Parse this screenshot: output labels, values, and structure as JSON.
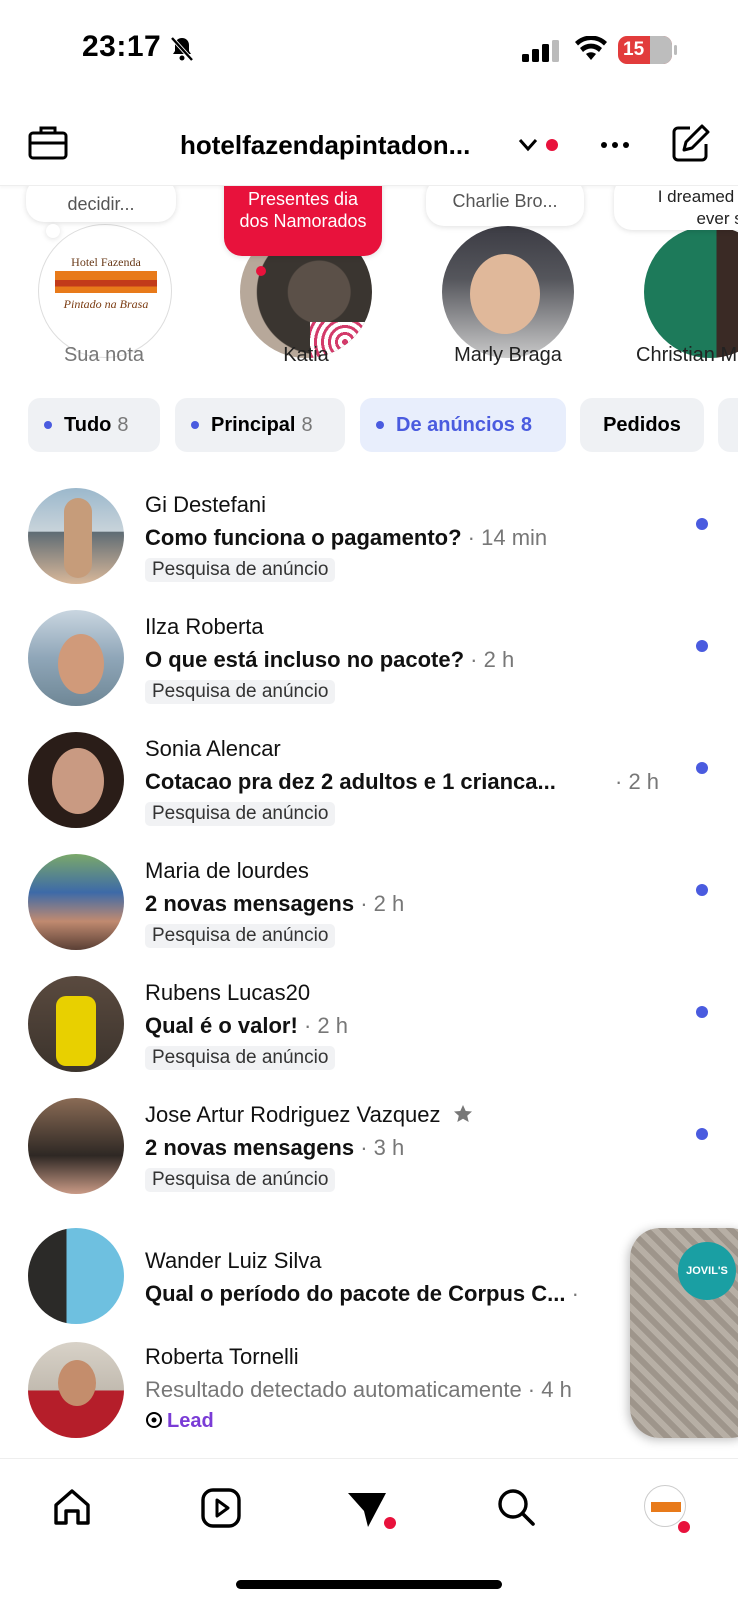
{
  "status_bar": {
    "time": "23:17",
    "battery": "15"
  },
  "header": {
    "account": "hotelfazendapintadon..."
  },
  "notes": [
    {
      "bubble": "decidir...",
      "name": "Sua nota",
      "logo_line1": "Hotel Fazenda",
      "logo_line2": "Pintado na Brasa"
    },
    {
      "bubble": "Presentes dia dos Namorados",
      "name": "Katia"
    },
    {
      "bubble": "Charlie Bro...",
      "name": "Marly Braga"
    },
    {
      "bubble": "I dreamed all ever sin",
      "name": "Christian M"
    }
  ],
  "filters": [
    {
      "label": "Tudo",
      "count": "8"
    },
    {
      "label": "Principal",
      "count": "8"
    },
    {
      "label": "De anúncios",
      "count": "8",
      "active": true
    },
    {
      "label": "Pedidos",
      "count": ""
    }
  ],
  "messages": [
    {
      "name": "Gi Destefani",
      "text": "Como funciona o pagamento?",
      "time": " · 14 min",
      "tag": "Pesquisa de anúncio",
      "unread": true
    },
    {
      "name": "Ilza Roberta",
      "text": "O que está incluso no pacote?",
      "time": " · 2 h",
      "tag": "Pesquisa de anúncio",
      "unread": true
    },
    {
      "name": "Sonia Alencar",
      "text": "Cotacao pra dez 2 adultos e 1 crianca...",
      "time": " · 2 h",
      "tag": "Pesquisa de anúncio",
      "unread": true
    },
    {
      "name": "Maria de lourdes",
      "text": "2 novas mensagens",
      "time": " · 2 h",
      "tag": "Pesquisa de anúncio",
      "unread": true
    },
    {
      "name": "Rubens Lucas20",
      "text": "Qual é o valor!",
      "time": " · 2 h",
      "tag": "Pesquisa de anúncio",
      "unread": true
    },
    {
      "name": "Jose Artur Rodriguez Vazquez",
      "text": "2 novas mensagens",
      "time": " · 3 h",
      "tag": "Pesquisa de anúncio",
      "unread": true
    },
    {
      "name": "Wander Luiz Silva",
      "text": "Qual o período do pacote de Corpus C...",
      "time": " ·",
      "tag": "",
      "unread": false
    },
    {
      "name": "Roberta Tornelli",
      "text": "Resultado detectado automaticamente",
      "time": " · 4 h",
      "tag": "Lead",
      "unread": false
    }
  ],
  "floating_badge": "JOVIL'S",
  "tabbar": {
    "items": [
      "home",
      "reels",
      "messages",
      "search",
      "profile"
    ]
  },
  "colors": {
    "accent": "#4a5bdf",
    "notification": "#e8123c",
    "lead": "#7a3cd6"
  }
}
